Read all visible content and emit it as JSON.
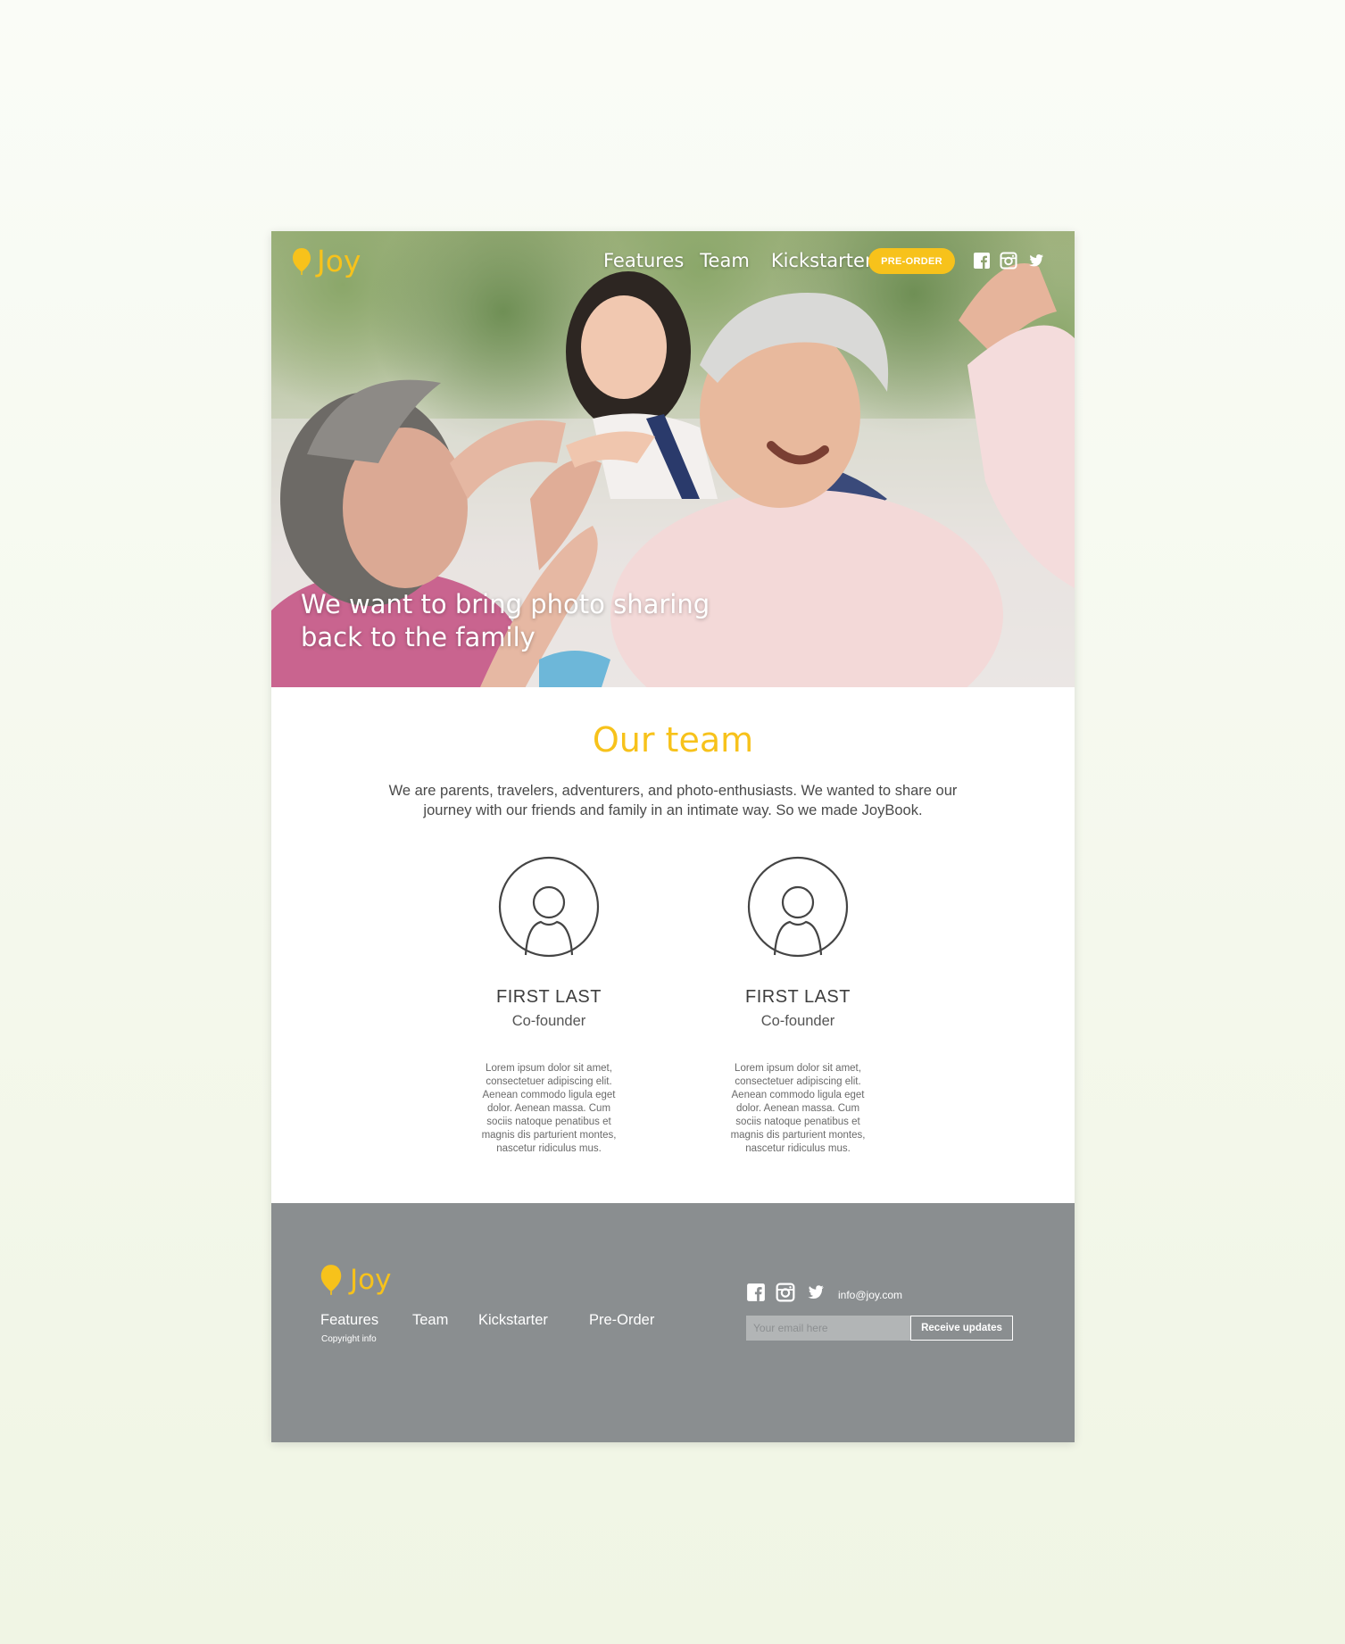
{
  "brand": {
    "name": "Joy",
    "accent_color": "#f7c21b"
  },
  "header": {
    "nav": [
      "Features",
      "Team",
      "Kickstarter"
    ],
    "preorder_label": "PRE-ORDER",
    "social_icons": [
      "facebook-icon",
      "instagram-icon",
      "twitter-icon"
    ]
  },
  "hero": {
    "headline_line1": "We want to bring photo sharing",
    "headline_line2": "back to the family"
  },
  "team": {
    "title": "Our team",
    "description": "We are parents, travelers, adventurers, and photo-enthusiasts. We wanted to share our journey with our friends and family in an intimate way. So we made JoyBook.",
    "members": [
      {
        "name": "FIRST LAST",
        "role": "Co-founder",
        "bio": "Lorem ipsum dolor sit amet, consectetuer adipiscing elit. Aenean commodo ligula eget dolor. Aenean massa. Cum sociis natoque penatibus et magnis dis parturient montes, nascetur ridiculus mus."
      },
      {
        "name": "FIRST LAST",
        "role": "Co-founder",
        "bio": "Lorem ipsum dolor sit amet, consectetuer adipiscing elit. Aenean commodo ligula eget dolor. Aenean massa. Cum sociis natoque penatibus et magnis dis parturient montes, nascetur ridiculus mus."
      }
    ]
  },
  "footer": {
    "nav": [
      "Features",
      "Team",
      "Kickstarter",
      "Pre-Order"
    ],
    "copyright": "Copyright info",
    "email": "info@joy.com",
    "email_placeholder": "Your email here",
    "button_label": "Receive updates",
    "background_color": "#8a8e90"
  }
}
